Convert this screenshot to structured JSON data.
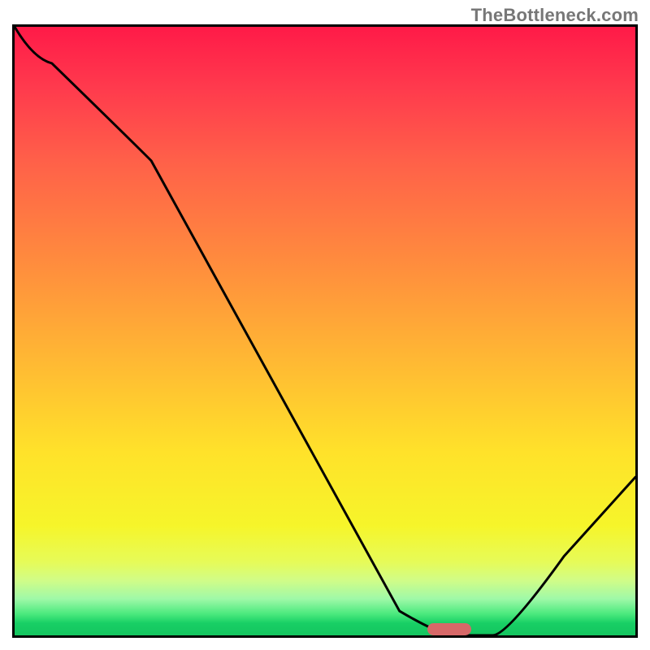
{
  "watermark": "TheBottleneck.com",
  "chart_data": {
    "type": "line",
    "title": "",
    "xlabel": "",
    "ylabel": "",
    "xlim": [
      0,
      100
    ],
    "ylim": [
      0,
      100
    ],
    "grid": false,
    "legend": false,
    "series": [
      {
        "name": "curve",
        "x": [
          0,
          6,
          22,
          62,
          71,
          77,
          100
        ],
        "y": [
          100,
          94,
          78,
          4,
          0,
          0,
          26
        ]
      }
    ],
    "marker": {
      "x_center": 70,
      "y": 0,
      "width": 7,
      "height": 2,
      "color": "#d76868",
      "shape": "capsule"
    },
    "gradient_stops": [
      {
        "pos": 0,
        "color": "#ff1a48"
      },
      {
        "pos": 0.22,
        "color": "#ff6049"
      },
      {
        "pos": 0.54,
        "color": "#ffb634"
      },
      {
        "pos": 0.82,
        "color": "#f6f52a"
      },
      {
        "pos": 0.96,
        "color": "#4ae97d"
      },
      {
        "pos": 1.0,
        "color": "#14c55f"
      }
    ]
  }
}
